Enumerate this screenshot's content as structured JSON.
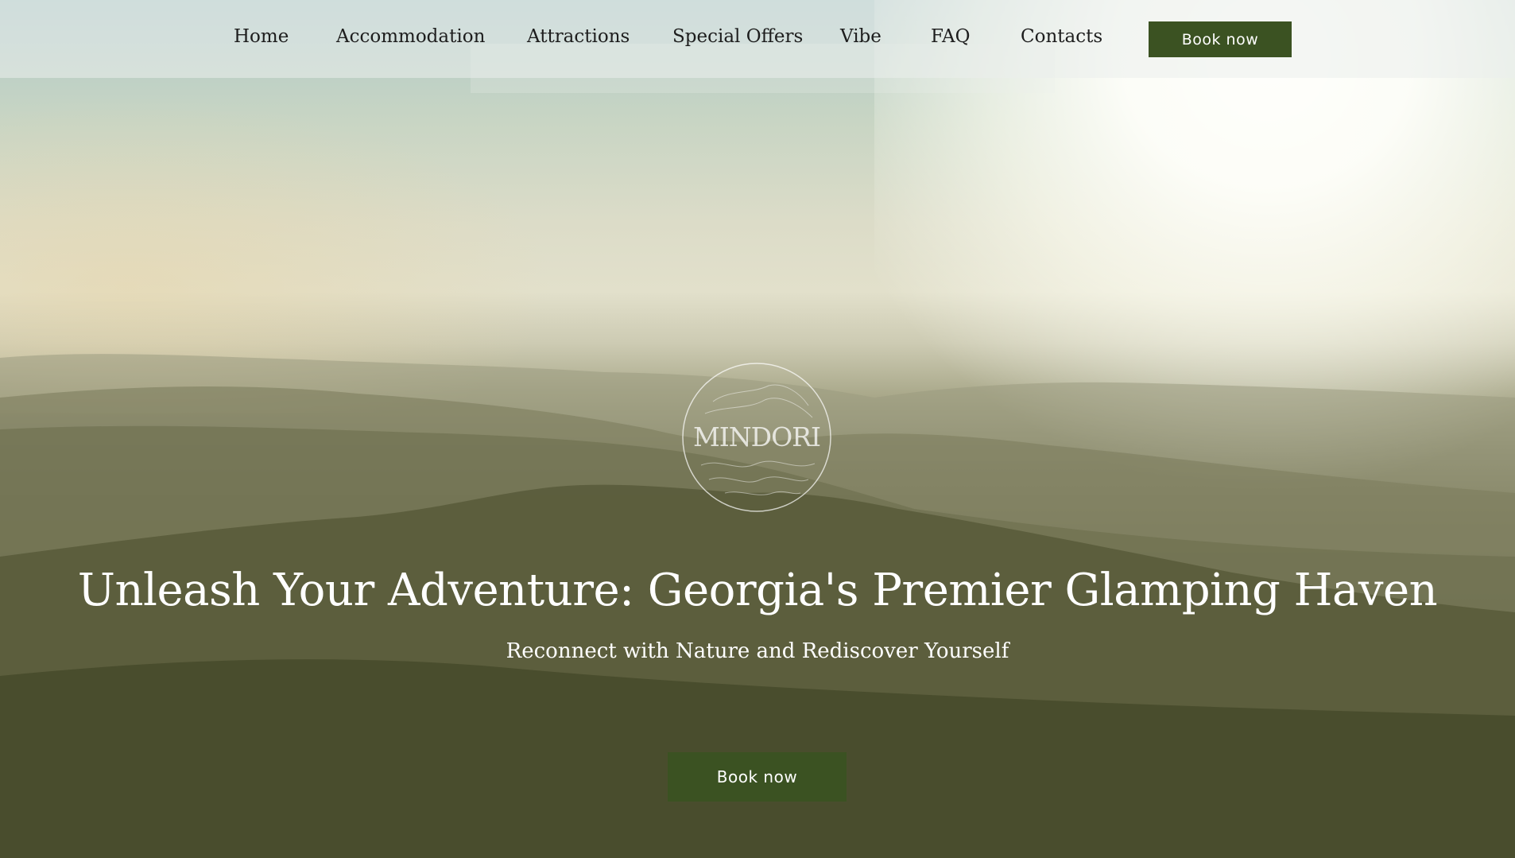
{
  "nav": {
    "items": [
      {
        "label": "Home",
        "name": "nav-home"
      },
      {
        "label": "Accommodation",
        "name": "nav-accommodation"
      },
      {
        "label": "Attractions",
        "name": "nav-attractions"
      },
      {
        "label": "Special Offers",
        "name": "nav-special-offers"
      },
      {
        "label": "Vibe",
        "name": "nav-vibe"
      },
      {
        "label": "FAQ",
        "name": "nav-faq"
      },
      {
        "label": "Contacts",
        "name": "nav-contacts"
      }
    ],
    "book_label": "Book now"
  },
  "hero": {
    "logo_text": "MINDORI",
    "headline": "Unleash Your Adventure: Georgia's Premier Glamping Haven",
    "subheadline": "Reconnect with Nature and Rediscover Yourself",
    "cta_label": "Book now"
  },
  "colors": {
    "accent": "#3b5222",
    "nav_text": "#1d1d1d",
    "hero_text": "#ffffff"
  }
}
